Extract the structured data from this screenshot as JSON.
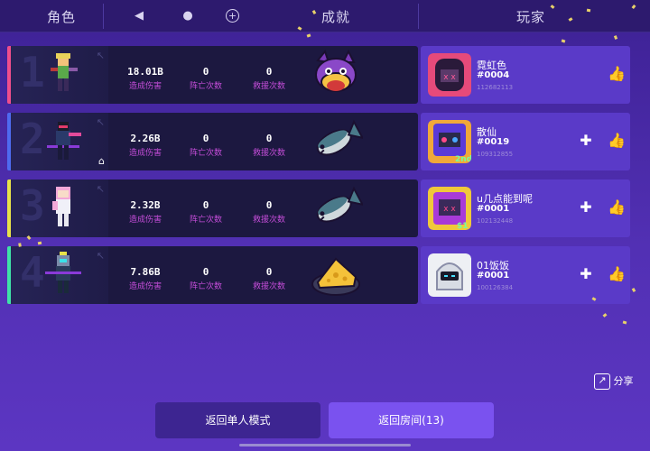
{
  "header": {
    "tab_hero": "角色",
    "tab_achievement": "成就",
    "tab_player": "玩家"
  },
  "rows": [
    {
      "rank": "1",
      "accent": "#ef4e8c",
      "damage": "18.01B",
      "damage_label": "造成伤害",
      "deaths": "0",
      "deaths_label": "阵亡次数",
      "rescues": "0",
      "rescues_label": "救援次数",
      "achievement_icon": "wolf-icon",
      "player": {
        "name": "霓虹色",
        "tag": "#0004",
        "id": "112682113",
        "has_add_friend": false
      }
    },
    {
      "rank": "2",
      "accent": "#4f6bf0",
      "damage": "2.26B",
      "damage_label": "造成伤害",
      "deaths": "0",
      "deaths_label": "阵亡次数",
      "rescues": "0",
      "rescues_label": "救援次数",
      "achievement_icon": "fish-icon",
      "player": {
        "name": "散仙",
        "tag": "#0019",
        "id": "109312855",
        "has_add_friend": true
      }
    },
    {
      "rank": "3",
      "accent": "#e8e24a",
      "damage": "2.32B",
      "damage_label": "造成伤害",
      "deaths": "0",
      "deaths_label": "阵亡次数",
      "rescues": "0",
      "rescues_label": "救援次数",
      "achievement_icon": "fish-icon",
      "player": {
        "name": "u几点能到呢",
        "tag": "#0001",
        "id": "102132448",
        "has_add_friend": true
      }
    },
    {
      "rank": "4",
      "accent": "#3fe2a8",
      "damage": "7.86B",
      "damage_label": "造成伤害",
      "deaths": "0",
      "deaths_label": "阵亡次数",
      "rescues": "0",
      "rescues_label": "救援次数",
      "achievement_icon": "cheese-icon",
      "player": {
        "name": "01饭饭",
        "tag": "#0001",
        "id": "100126384",
        "has_add_friend": true
      }
    }
  ],
  "share_label": "分享",
  "buttons": {
    "back_single": "返回单人模式",
    "back_room": "返回房间(13)"
  }
}
